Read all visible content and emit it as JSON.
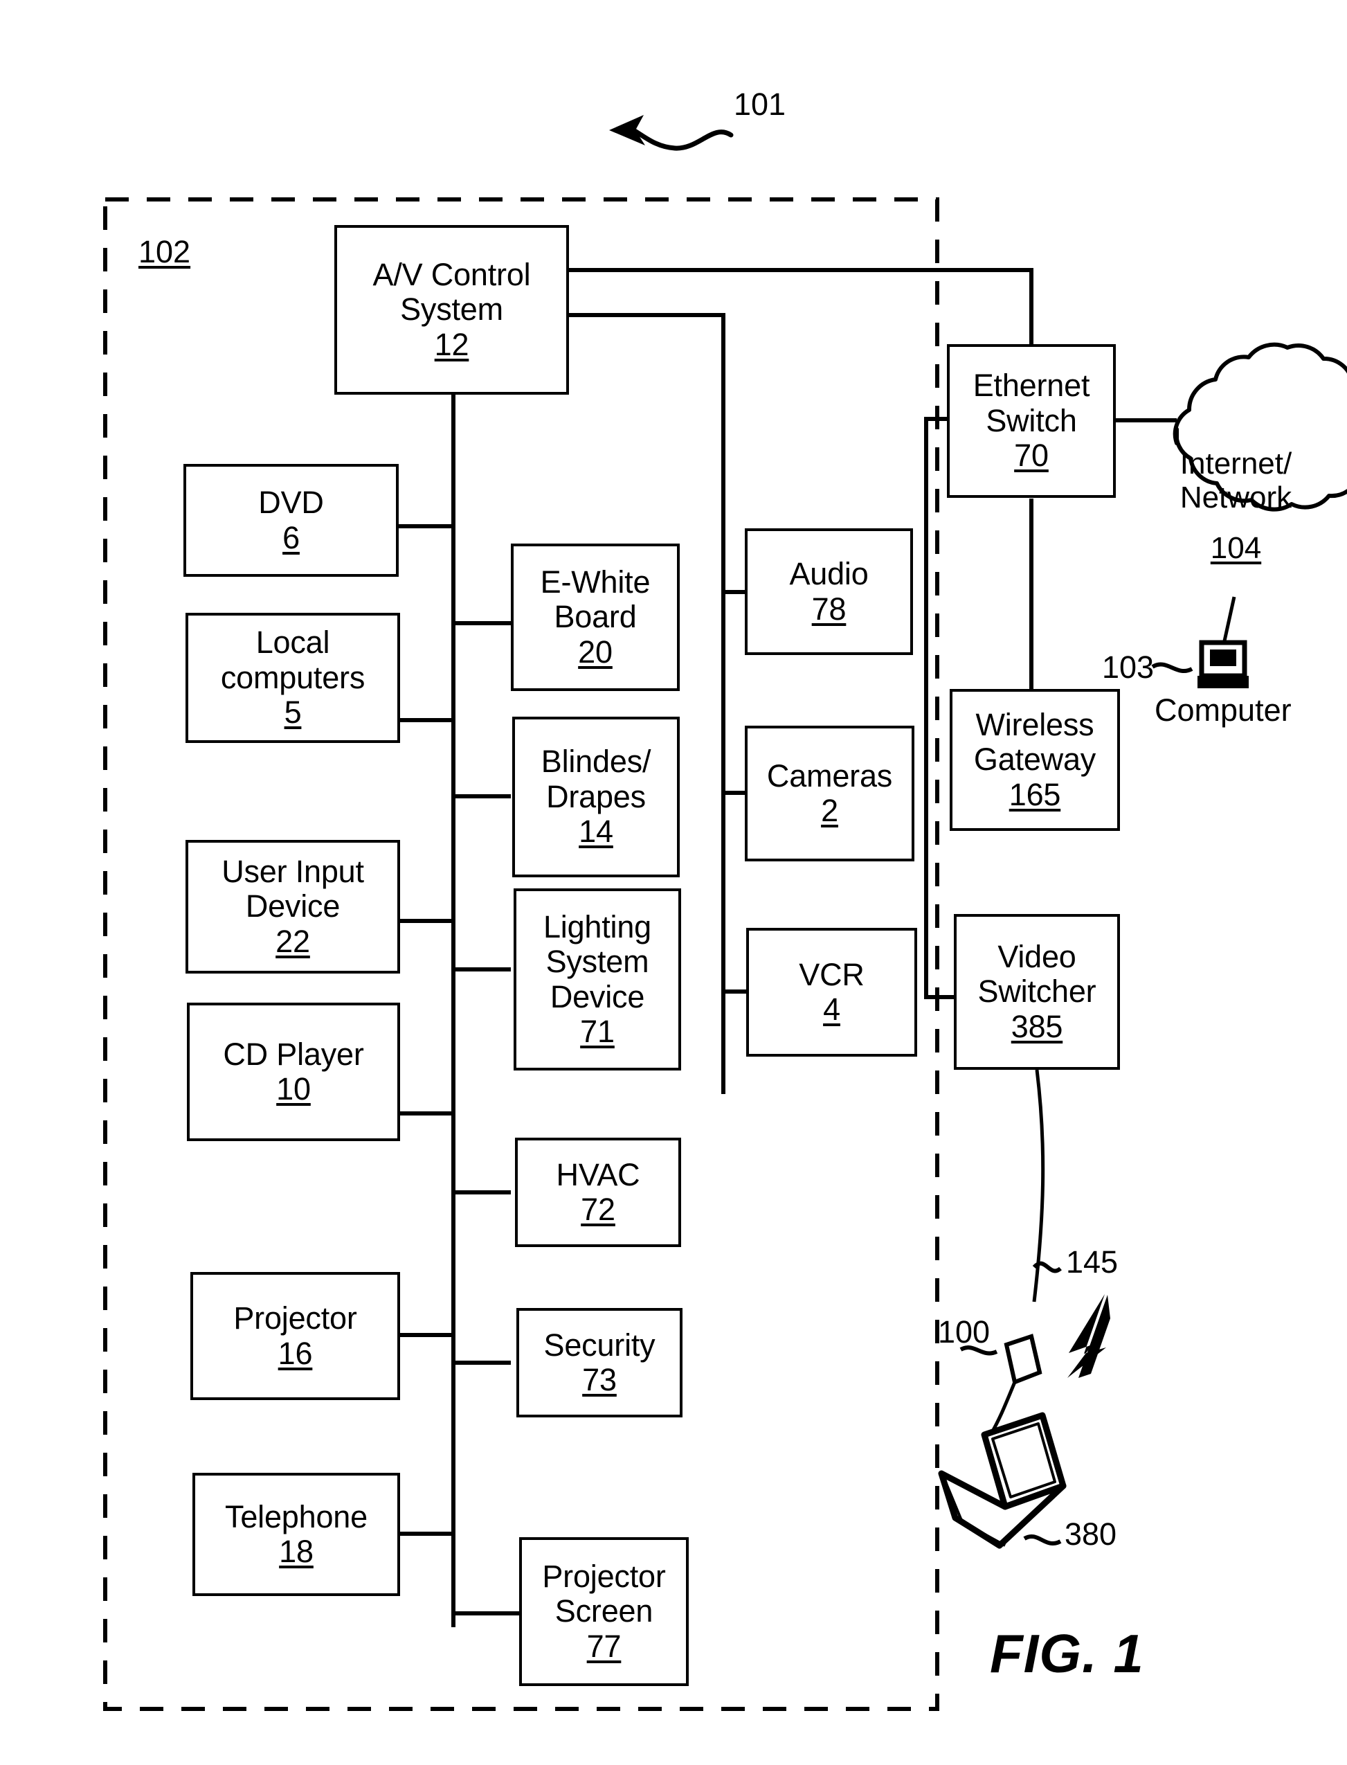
{
  "figure": {
    "caption": "FIG. 1",
    "system_ref": "101",
    "room_boundary_ref": "102"
  },
  "nodes": {
    "av_control": {
      "label": "A/V Control\nSystem",
      "number": "12"
    },
    "dvd": {
      "label": "DVD",
      "number": "6"
    },
    "local_computers": {
      "label": "Local\ncomputers",
      "number": "5"
    },
    "user_input_device": {
      "label": "User Input\nDevice",
      "number": "22"
    },
    "cd_player": {
      "label": "CD Player",
      "number": "10"
    },
    "projector": {
      "label": "Projector",
      "number": "16"
    },
    "telephone": {
      "label": "Telephone",
      "number": "18"
    },
    "ewhite_board": {
      "label": "E-White\nBoard",
      "number": "20"
    },
    "blinds_drapes": {
      "label": "Blindes/\nDrapes",
      "number": "14"
    },
    "lighting_system_device": {
      "label": "Lighting\nSystem\nDevice",
      "number": "71"
    },
    "hvac": {
      "label": "HVAC",
      "number": "72"
    },
    "security": {
      "label": "Security",
      "number": "73"
    },
    "projector_screen": {
      "label": "Projector\nScreen",
      "number": "77"
    },
    "audio": {
      "label": "Audio",
      "number": "78"
    },
    "cameras": {
      "label": "Cameras",
      "number": "2"
    },
    "vcr": {
      "label": "VCR",
      "number": "4"
    },
    "ethernet_switch": {
      "label": "Ethernet\nSwitch",
      "number": "70"
    },
    "wireless_gateway": {
      "label": "Wireless\nGateway",
      "number": "165"
    },
    "video_switcher": {
      "label": "Video\nSwitcher",
      "number": "385"
    }
  },
  "cloud": {
    "label": "Internet/\nNetwork",
    "number": "104"
  },
  "computer": {
    "ref": "103",
    "label": "Computer"
  },
  "wireless": {
    "dongle_ref": "100",
    "link_ref": "145",
    "laptop_ref": "380"
  }
}
